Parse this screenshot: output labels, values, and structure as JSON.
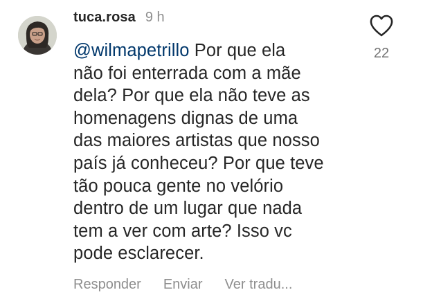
{
  "comment": {
    "username": "tuca.rosa",
    "timestamp": "9 h",
    "mention": "@wilmapetrillo",
    "lines": [
      " Por que ela",
      "não foi enterrada com a mãe",
      "dela? Por que ela não teve as",
      "homenagens dignas de uma",
      "das maiores artistas que nosso",
      "país já conheceu? Por que teve",
      "tão pouca gente no velório",
      "dentro de um lugar que nada",
      "tem a ver com arte? Isso vc",
      "pode esclarecer."
    ],
    "like_icon": "heart-outline-icon",
    "like_count": "22",
    "actions": {
      "reply": "Responder",
      "send": "Enviar",
      "translate": "Ver tradu..."
    }
  },
  "colors": {
    "text": "#262626",
    "mention": "#00376b",
    "secondary": "#8e8e8e",
    "background": "#ffffff"
  }
}
